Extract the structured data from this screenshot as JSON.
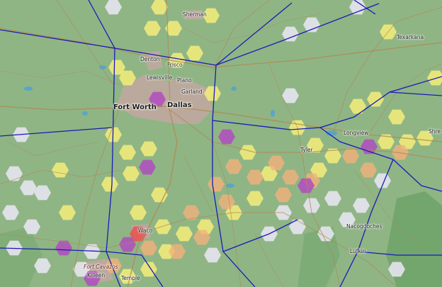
{
  "map": {
    "cities": [
      {
        "id": "sherman",
        "name": "Sherman"
      },
      {
        "id": "texarkana",
        "name": "Texarkana"
      },
      {
        "id": "denton",
        "name": "Denton"
      },
      {
        "id": "frisco",
        "name": "Frisco"
      },
      {
        "id": "lewisville",
        "name": "Lewisville"
      },
      {
        "id": "plano",
        "name": "Plano"
      },
      {
        "id": "garland",
        "name": "Garland"
      },
      {
        "id": "fort-worth",
        "name": "Fort Worth"
      },
      {
        "id": "dallas",
        "name": "Dallas"
      },
      {
        "id": "longview",
        "name": "Longview"
      },
      {
        "id": "shreveport-partial",
        "name": "Shre"
      },
      {
        "id": "tyler",
        "name": "Tyler"
      },
      {
        "id": "nacogdoches",
        "name": "Nacogdoches"
      },
      {
        "id": "lufkin",
        "name": "Lufkin"
      },
      {
        "id": "waco",
        "name": "Waco"
      },
      {
        "id": "fort-cavazos",
        "name": "Fort Cavazos"
      },
      {
        "id": "killeen",
        "name": "Killeen"
      },
      {
        "id": "temple",
        "name": "Temple"
      }
    ],
    "colors": {
      "land": "#8fb585",
      "boundary": "#1a1ab8",
      "hex_white": "#e6e4ee",
      "hex_yellow": "#f2ec7a",
      "hex_orange": "#f3b27a",
      "hex_red": "#ec5050",
      "hex_purple": "#b04cc0",
      "urban": "#c9a6a6",
      "road": "#b08a52"
    }
  }
}
